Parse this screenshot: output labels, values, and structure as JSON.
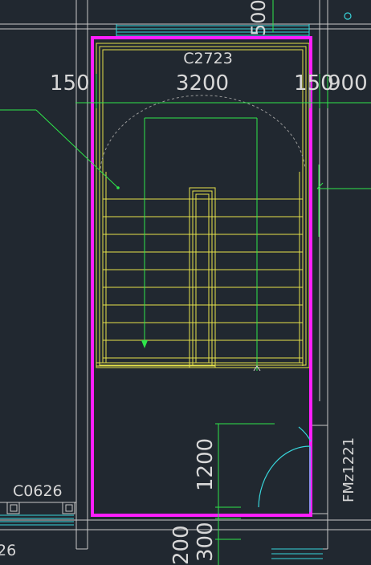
{
  "drawing": {
    "window_label_top": "C2723",
    "dim_top_left": "150",
    "dim_top_main": "3200",
    "dim_top_right_a": "150",
    "dim_top_right_b": "900",
    "dim_vertical_1200": "1200",
    "dim_vertical_300": "300",
    "dim_vertical_200": "200",
    "dim_top_clipped": "500",
    "window_label_left": "C0626",
    "clipped_label_left": "26",
    "door_label_right": "FMz1221"
  },
  "colors": {
    "background": "#212830",
    "wall": "#c9c9c9",
    "stair": "#e6e24a",
    "highlight": "#ff1eff",
    "annotation": "#2ee64a",
    "window": "#38d6dc",
    "text": "#d8d8d8"
  }
}
